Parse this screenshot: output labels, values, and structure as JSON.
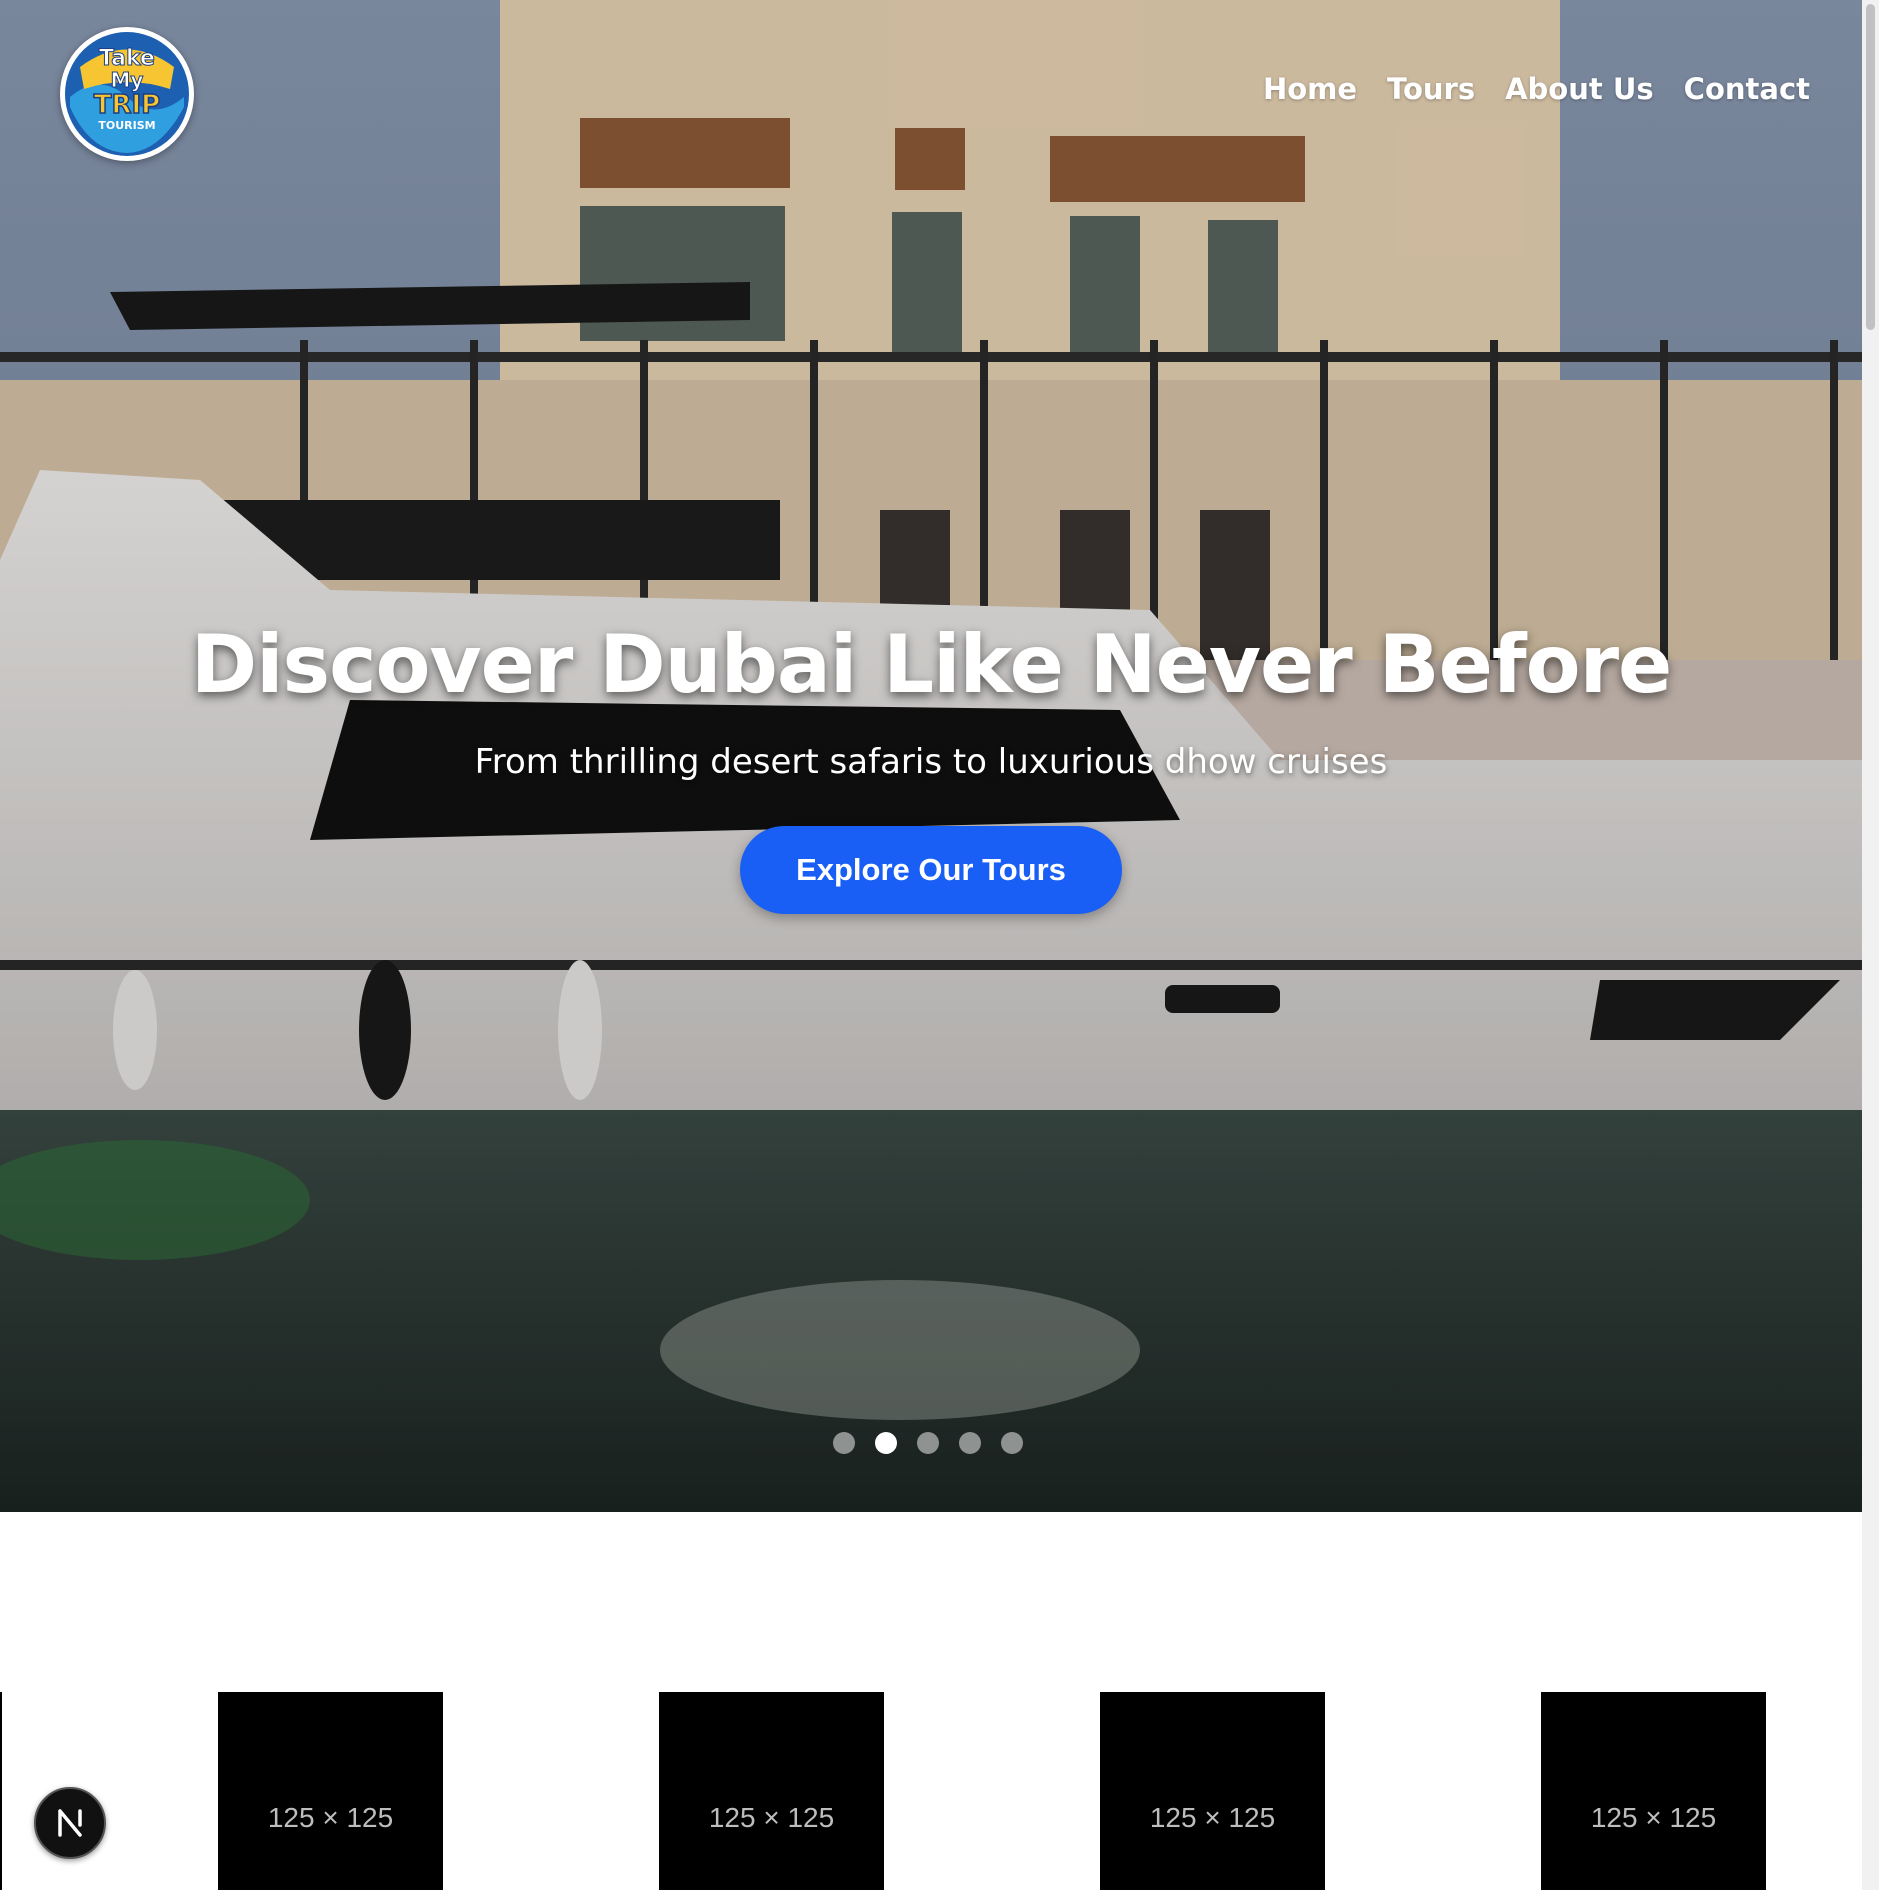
{
  "brand": {
    "logo_line1": "Take",
    "logo_line2": "My",
    "logo_line3": "TRIP",
    "logo_line4": "TOURISM"
  },
  "nav": {
    "items": [
      {
        "label": "Home"
      },
      {
        "label": "Tours"
      },
      {
        "label": "About Us"
      },
      {
        "label": "Contact"
      }
    ]
  },
  "hero": {
    "title": "Discover Dubai Like Never Before",
    "subtitle": "From thrilling desert safaris to luxurious dhow cruises",
    "cta_label": "Explore Our Tours",
    "slide_count": 5,
    "active_slide": 2
  },
  "partners": {
    "items": [
      {
        "label": "125 × 125"
      },
      {
        "label": "125 × 125"
      },
      {
        "label": "125 × 125"
      },
      {
        "label": "125 × 125"
      }
    ]
  },
  "colors": {
    "accent": "#1a5ff5",
    "nav_text": "#ffffff"
  },
  "icons": {
    "dev_badge": "nextjs-icon"
  }
}
